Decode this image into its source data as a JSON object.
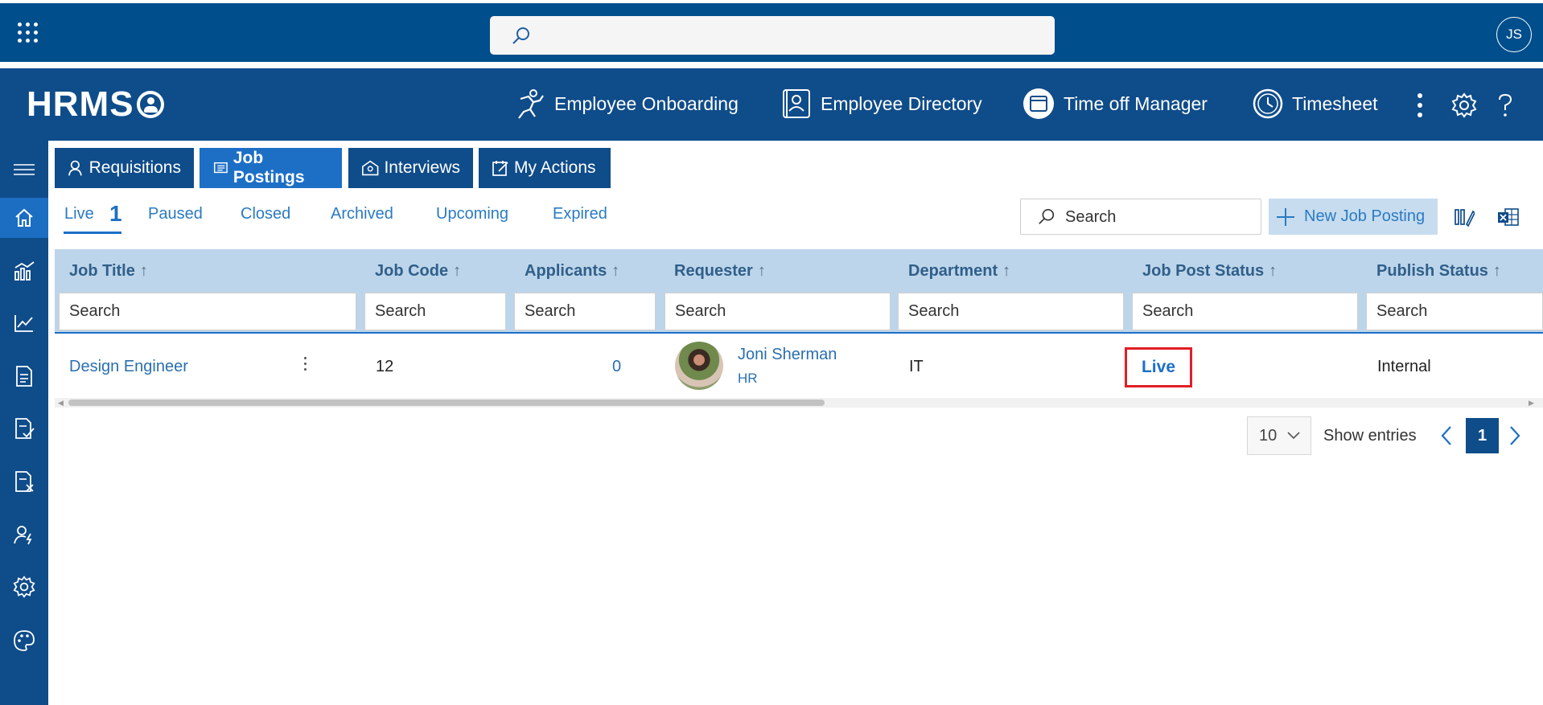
{
  "suite": {
    "avatar_initials": "JS"
  },
  "header": {
    "logo": "HRMS",
    "nav": [
      {
        "label": "Employee Onboarding",
        "icon": "running-person-icon"
      },
      {
        "label": "Employee Directory",
        "icon": "directory-icon"
      },
      {
        "label": "Time off Manager",
        "icon": "calendar-icon"
      },
      {
        "label": "Timesheet",
        "icon": "clock-icon"
      }
    ],
    "actions": [
      "more-vertical-icon",
      "gear-icon",
      "help-icon"
    ]
  },
  "rail": {
    "items": [
      "menu-icon",
      "home-icon",
      "analytics-icon",
      "line-chart-icon",
      "document-icon",
      "document-check-icon",
      "document-remove-icon",
      "person-lightning-icon",
      "gear-icon",
      "palette-icon"
    ],
    "active": "home-icon"
  },
  "tabs": [
    {
      "label": "Requisitions",
      "icon": "person-icon"
    },
    {
      "label": "Job Postings",
      "icon": "postings-icon",
      "active": true
    },
    {
      "label": "Interviews",
      "icon": "interview-icon"
    },
    {
      "label": "My Actions",
      "icon": "actions-icon"
    }
  ],
  "subtabs": {
    "items": [
      "Live",
      "Paused",
      "Closed",
      "Archived",
      "Upcoming",
      "Expired"
    ],
    "active": "Live",
    "live_count": "1"
  },
  "toolbar": {
    "search_placeholder": "Search",
    "new_label": "New Job Posting"
  },
  "table": {
    "columns": [
      "Job Title",
      "Job Code",
      "Applicants",
      "Requester",
      "Department",
      "Job Post Status",
      "Publish Status"
    ],
    "sort_arrow": "↑",
    "filter_placeholder": "Search",
    "rows": [
      {
        "job_title": "Design Engineer",
        "job_code": "12",
        "applicants": "0",
        "requester_name": "Joni Sherman",
        "requester_dept": "HR",
        "department": "IT",
        "job_post_status": "Live",
        "publish_status": "Internal"
      }
    ]
  },
  "pager": {
    "page_size": "10",
    "show_entries_label": "Show entries",
    "current_page": "1"
  },
  "colors": {
    "suite_bar": "#004e8c",
    "app_bar": "#0f4c8a",
    "accent": "#1d6fc6",
    "table_header": "#bdd5ea",
    "highlight": "#e01e25"
  }
}
